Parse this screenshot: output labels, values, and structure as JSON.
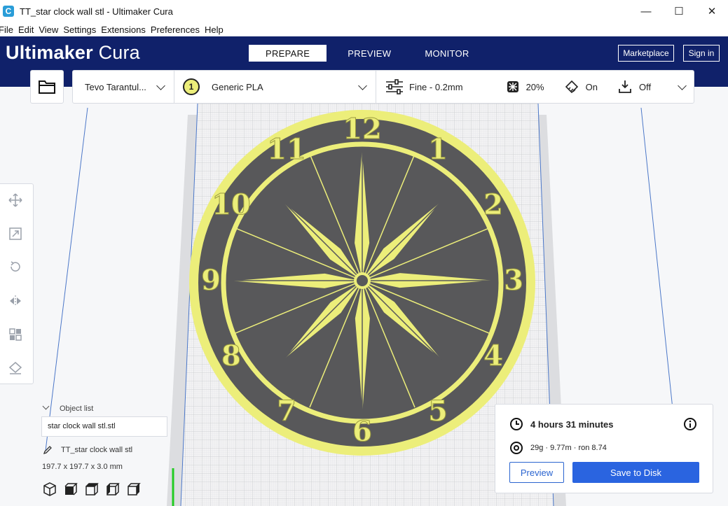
{
  "window": {
    "title": "TT_star clock wall stl - Ultimaker Cura",
    "app_icon_letter": "C",
    "minimize_glyph": "—",
    "maximize_glyph": "☐",
    "close_glyph": "✕"
  },
  "menu": [
    "File",
    "Edit",
    "View",
    "Settings",
    "Extensions",
    "Preferences",
    "Help"
  ],
  "header": {
    "logo_bold": "Ultimaker",
    "logo_light": "Cura",
    "tabs": [
      {
        "label": "PREPARE",
        "active": true
      },
      {
        "label": "PREVIEW",
        "active": false
      },
      {
        "label": "MONITOR",
        "active": false
      }
    ],
    "marketplace_label": "Marketplace",
    "signin_label": "Sign in"
  },
  "toolbar": {
    "printer": "Tevo Tarantul...",
    "extruder_number": "1",
    "material": "Generic PLA",
    "profile": "Fine - 0.2mm",
    "infill": "20%",
    "support": "On",
    "adhesion": "Off"
  },
  "object_list": {
    "title": "Object list",
    "object_name": "star clock wall stl.stl",
    "job_name": "TT_star clock wall stl",
    "dimensions": "197.7 x 197.7 x 3.0 mm"
  },
  "print_info": {
    "time": "4 hours 31 minutes",
    "material_usage": "29g · 9.77m · ron 8.74",
    "preview_label": "Preview",
    "save_label": "Save to Disk"
  },
  "model": {
    "numerals": [
      "12",
      "1",
      "2",
      "3",
      "4",
      "5",
      "6",
      "7",
      "8",
      "9",
      "10",
      "11"
    ],
    "model_color": "#ecee7a",
    "plate_color": "#58585a"
  },
  "colors": {
    "header_bg": "#10216a",
    "accent_blue": "#2a64e0"
  }
}
